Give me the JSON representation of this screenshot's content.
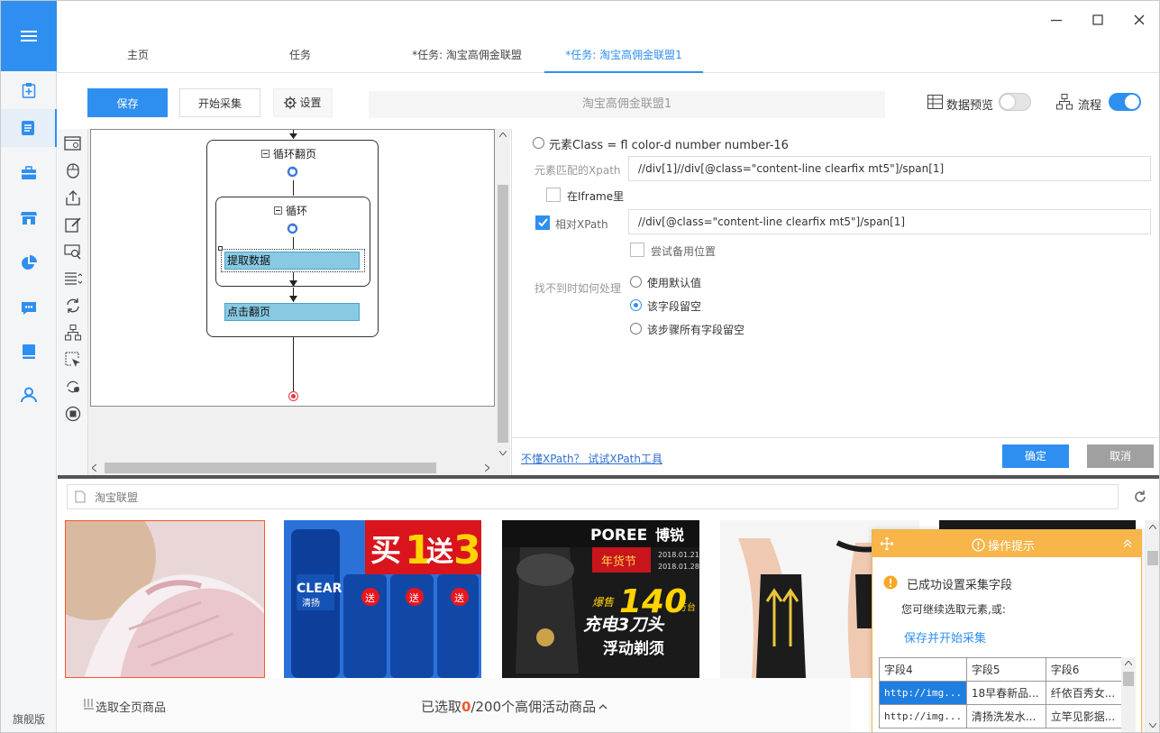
{
  "sidebar": {
    "edition": "旗舰版"
  },
  "tabs": [
    "主页",
    "任务",
    "*任务: 淘宝高佣金联盟",
    "*任务: 淘宝高佣金联盟1"
  ],
  "toolbar": {
    "save": "保存",
    "start": "开始采集",
    "settings": "设置",
    "task_name": "淘宝高佣金联盟1",
    "data_preview": "数据预览",
    "flow": "流程"
  },
  "workflow": {
    "loop_page": "循环翻页",
    "loop": "循环",
    "extract": "提取数据",
    "click_next": "点击翻页"
  },
  "panel": {
    "class_option": "元素Class = fl color-d number number-16",
    "xpath_label": "元素匹配的Xpath",
    "xpath_value": "//div[1]//div[@class=\"content-line clearfix mt5\"]/span[1]",
    "iframe": "在Iframe里",
    "relative_label": "相对XPath",
    "relative_value": "//div[@class=\"content-line clearfix mt5\"]/span[1]",
    "backup": "尝试备用位置",
    "notfound_label": "找不到时如何处理",
    "options": [
      "使用默认值",
      "该字段留空",
      "该步骤所有字段留空"
    ],
    "xpath_tool_link": "不懂XPath？ 试试XPath工具",
    "ok": "确定",
    "cancel": "取消"
  },
  "browser": {
    "url": "淘宝联盟",
    "select_all": "选取全页商品",
    "selected_prefix": "已选取",
    "selected_count": "0",
    "selected_suffix": "/200个高佣活动商品",
    "ad_texts": {
      "buy": "买",
      "one": "1",
      "give": "送",
      "three": "3",
      "clear": "CLEAR",
      "clear_cn": "清扬",
      "gift": "送",
      "poree": "POREE",
      "poree_cn": "博锐",
      "festival": "年货节",
      "date1": "2018.01.21",
      "date2": "2018.01.28",
      "hot": "爆售",
      "number": "140",
      "unit": "万台",
      "slogan1": "充电3刀头",
      "slogan2": "浮动剃须"
    }
  },
  "tips": {
    "title": "操作提示",
    "success": "已成功设置采集字段",
    "continue": "您可继续选取元素,或:",
    "save_start": "保存并开始采集",
    "headers": [
      "字段4",
      "字段5",
      "字段6"
    ],
    "rows": [
      [
        "http://img...",
        "18早春新品...",
        "纤依百秀女..."
      ],
      [
        "http://img...",
        "清扬洗发水...",
        "立竿见影据..."
      ]
    ]
  },
  "colors": {
    "accent": "#2f8ff0",
    "tips": "#f7b54a",
    "highlight": "#f2592c"
  }
}
